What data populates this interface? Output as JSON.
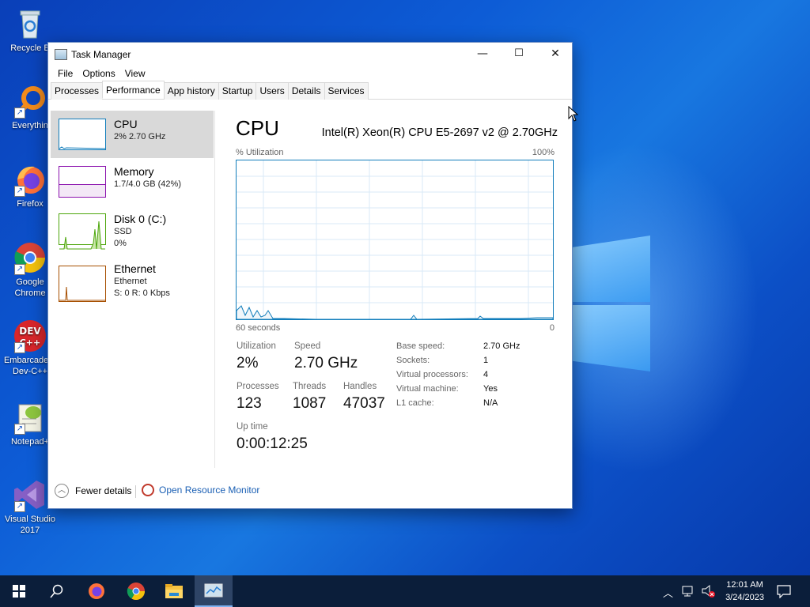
{
  "desktop": {
    "icons": [
      {
        "label": "Recycle Bin",
        "display": "Recycle B",
        "icon": "recycle-bin-icon"
      },
      {
        "label": "Everything",
        "display": "Everythin",
        "icon": "everything-search-icon"
      },
      {
        "label": "Firefox",
        "display": "Firefox",
        "icon": "firefox-icon"
      },
      {
        "label": "Google Chrome",
        "display": "Google Chrome",
        "icon": "chrome-icon"
      },
      {
        "label": "Embarcadero Dev-C++",
        "display": "Embarcadero Dev-C++",
        "icon": "devcpp-icon"
      },
      {
        "label": "Notepad++",
        "display": "Notepad+",
        "icon": "notepadpp-icon"
      },
      {
        "label": "Visual Studio 2017",
        "display": "Visual Studio 2017",
        "icon": "visual-studio-icon"
      }
    ]
  },
  "window": {
    "title": "Task Manager",
    "controls": {
      "minimize": "—",
      "maximize": "☐",
      "close": "✕"
    },
    "menu": [
      "File",
      "Options",
      "View"
    ],
    "tabs": [
      "Processes",
      "Performance",
      "App history",
      "Startup",
      "Users",
      "Details",
      "Services"
    ],
    "active_tab": "Performance"
  },
  "sidebar": {
    "items": [
      {
        "title": "CPU",
        "line1": "2% 2.70 GHz",
        "line2": "",
        "color": "#117dbb",
        "active": true
      },
      {
        "title": "Memory",
        "line1": "1.7/4.0 GB (42%)",
        "line2": "",
        "color": "#8b12ae",
        "active": false
      },
      {
        "title": "Disk 0 (C:)",
        "line1": "SSD",
        "line2": "0%",
        "color": "#4da60c",
        "active": false
      },
      {
        "title": "Ethernet",
        "line1": "Ethernet",
        "line2": "S: 0 R: 0 Kbps",
        "color": "#a74f01",
        "active": false
      }
    ]
  },
  "cpu": {
    "heading": "CPU",
    "model": "Intel(R) Xeon(R) CPU E5-2697 v2 @ 2.70GHz",
    "graph_label": "% Utilization",
    "graph_max": "100%",
    "time_label": "60 seconds",
    "time_zero": "0",
    "stats": {
      "utilization_label": "Utilization",
      "utilization": "2%",
      "speed_label": "Speed",
      "speed": "2.70 GHz",
      "processes_label": "Processes",
      "processes": "123",
      "threads_label": "Threads",
      "threads": "1087",
      "handles_label": "Handles",
      "handles": "47037",
      "uptime_label": "Up time",
      "uptime": "0:00:12:25"
    },
    "details": [
      {
        "k": "Base speed:",
        "v": "2.70 GHz"
      },
      {
        "k": "Sockets:",
        "v": "1"
      },
      {
        "k": "Virtual processors:",
        "v": "4"
      },
      {
        "k": "Virtual machine:",
        "v": "Yes"
      },
      {
        "k": "L1 cache:",
        "v": "N/A"
      }
    ]
  },
  "footer": {
    "fewer_details": "Fewer details",
    "open_resource_monitor": "Open Resource Monitor"
  },
  "taskbar": {
    "time": "12:01 AM",
    "date": "3/24/2023",
    "apps": [
      "start-icon",
      "search-icon",
      "firefox-icon",
      "chrome-icon",
      "file-explorer-icon",
      "task-manager-icon"
    ]
  }
}
